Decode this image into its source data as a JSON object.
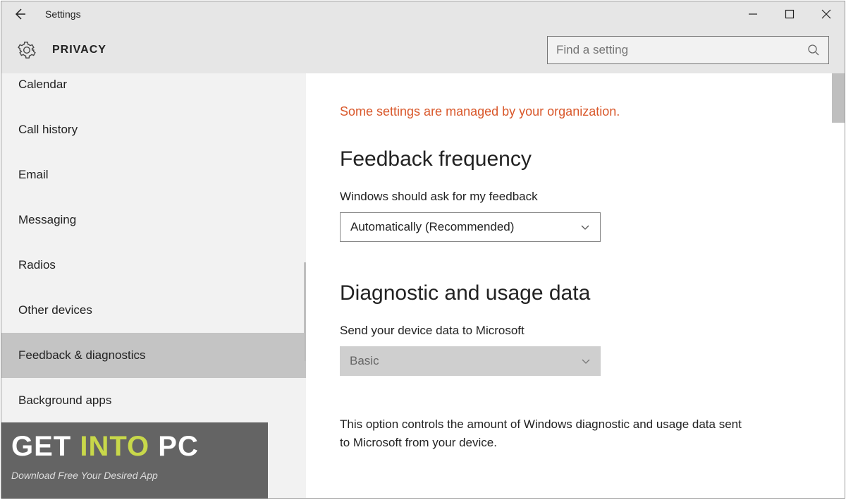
{
  "titlebar": {
    "title": "Settings"
  },
  "header": {
    "page_title": "PRIVACY",
    "search_placeholder": "Find a setting"
  },
  "sidebar": {
    "items": [
      {
        "label": "Calendar",
        "selected": false
      },
      {
        "label": "Call history",
        "selected": false
      },
      {
        "label": "Email",
        "selected": false
      },
      {
        "label": "Messaging",
        "selected": false
      },
      {
        "label": "Radios",
        "selected": false
      },
      {
        "label": "Other devices",
        "selected": false
      },
      {
        "label": "Feedback & diagnostics",
        "selected": true
      },
      {
        "label": "Background apps",
        "selected": false
      }
    ]
  },
  "content": {
    "warning": "Some settings are managed by your organization.",
    "section1": {
      "heading": "Feedback frequency",
      "label": "Windows should ask for my feedback",
      "select_value": "Automatically (Recommended)"
    },
    "section2": {
      "heading": "Diagnostic and usage data",
      "label": "Send your device data to Microsoft",
      "select_value": "Basic",
      "description": "This option controls the amount of Windows diagnostic and usage data sent to Microsoft from your device."
    }
  },
  "watermark": {
    "line1_a": "GET ",
    "line1_b": "INTO",
    "line1_c": " PC",
    "line2": "Download Free Your Desired App"
  }
}
